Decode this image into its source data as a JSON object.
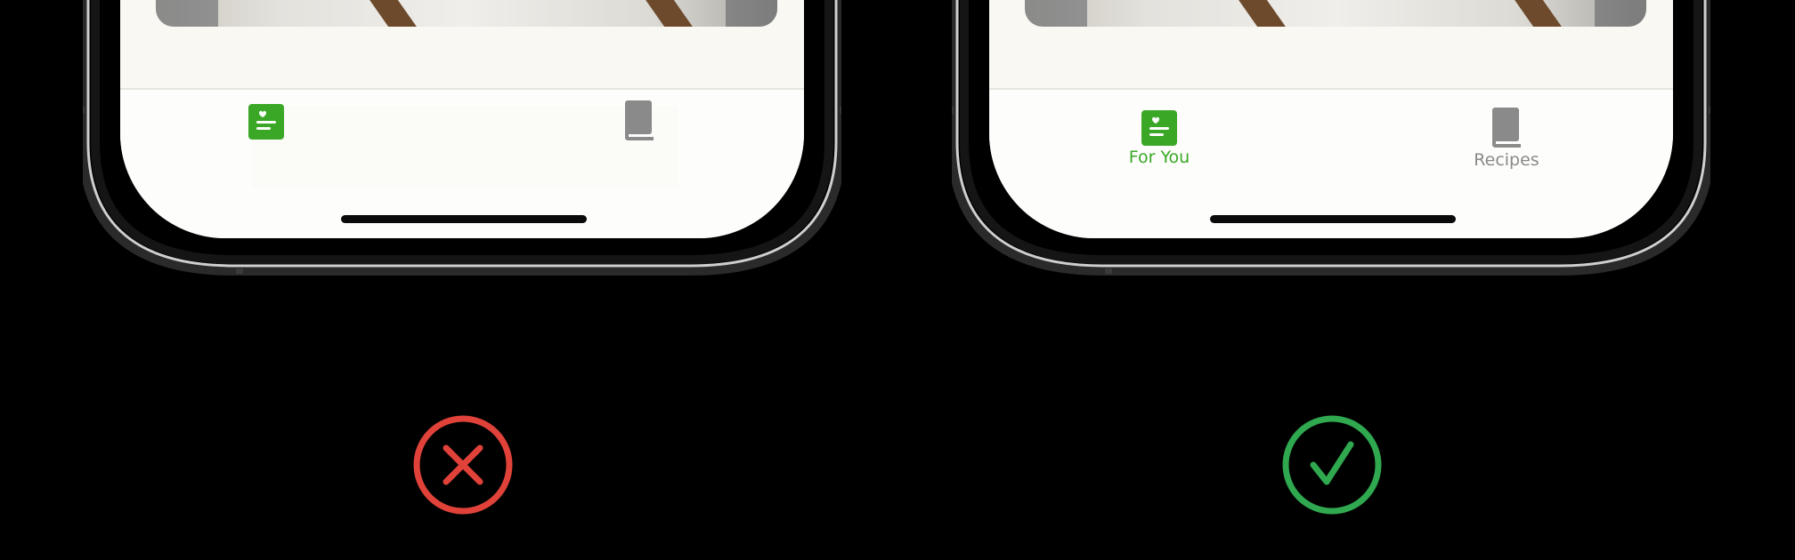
{
  "comparison": {
    "incorrect": {
      "verdict_icon": "x-circle-icon",
      "verdict_color": "#e0423a",
      "tabs": [
        {
          "icon": "for-you-icon",
          "active": true
        },
        {
          "icon": "book-icon",
          "active": false
        }
      ]
    },
    "correct": {
      "verdict_icon": "checkmark-circle-icon",
      "verdict_color": "#2fa84f",
      "tabs": [
        {
          "icon": "for-you-icon",
          "label": "For You",
          "active": true
        },
        {
          "icon": "book-icon",
          "label": "Recipes",
          "active": false
        }
      ]
    }
  },
  "colors": {
    "active_tint": "#3aa826",
    "inactive_tint": "#8a8a8a",
    "background": "#000000",
    "screen": "#faf8f3"
  }
}
